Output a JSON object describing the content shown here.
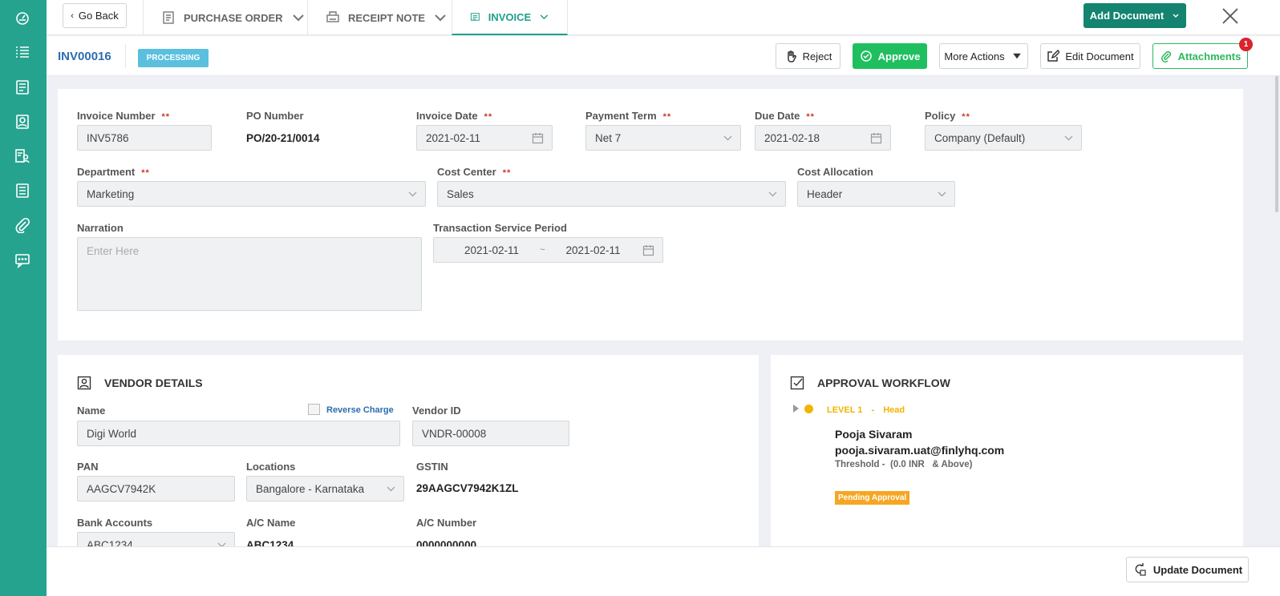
{
  "sidebar": {
    "icons": [
      "dashboard-icon",
      "list-icon",
      "document-icon",
      "contact-icon",
      "people-report-icon",
      "report-icon",
      "attachment-icon",
      "chat-icon"
    ]
  },
  "topbar": {
    "go_back": "Go Back",
    "tabs": [
      {
        "label": "PURCHASE ORDER",
        "icon": "purchase-order-icon"
      },
      {
        "label": "RECEIPT NOTE",
        "icon": "receipt-note-icon"
      },
      {
        "label": "INVOICE",
        "icon": "invoice-icon",
        "active": true
      }
    ],
    "add_document": "Add Document"
  },
  "actionbar": {
    "doc_id": "INV00016",
    "status": "PROCESSING",
    "reject": "Reject",
    "approve": "Approve",
    "more_actions": "More Actions",
    "edit_document": "Edit Document",
    "attachments": "Attachments",
    "attachments_count": "1"
  },
  "form": {
    "invoice_number": {
      "label": "Invoice Number",
      "value": "INV5786",
      "required": "**"
    },
    "po_number": {
      "label": "PO Number",
      "value": "PO/20-21/0014"
    },
    "invoice_date": {
      "label": "Invoice Date",
      "value": "2021-02-11",
      "required": "**"
    },
    "payment_term": {
      "label": "Payment Term",
      "value": "Net 7",
      "required": "**"
    },
    "due_date": {
      "label": "Due Date",
      "value": "2021-02-18",
      "required": "**"
    },
    "policy": {
      "label": "Policy",
      "value": "Company (Default)",
      "required": "**"
    },
    "department": {
      "label": "Department",
      "value": "Marketing",
      "required": "**"
    },
    "cost_center": {
      "label": "Cost Center",
      "value": "Sales",
      "required": "**"
    },
    "cost_allocation": {
      "label": "Cost Allocation",
      "value": "Header"
    },
    "narration": {
      "label": "Narration",
      "placeholder": "Enter Here"
    },
    "service_period": {
      "label": "Transaction Service Period",
      "from": "2021-02-11",
      "sep": "~",
      "to": "2021-02-11"
    }
  },
  "vendor": {
    "title": "VENDOR DETAILS",
    "name": {
      "label": "Name",
      "value": "Digi World"
    },
    "reverse_charge": "Reverse Charge",
    "vendor_id": {
      "label": "Vendor ID",
      "value": "VNDR-00008"
    },
    "pan": {
      "label": "PAN",
      "value": "AAGCV7942K"
    },
    "locations": {
      "label": "Locations",
      "value": "Bangalore - Karnataka"
    },
    "gstin": {
      "label": "GSTIN",
      "value": "29AAGCV7942K1ZL"
    },
    "bank_accounts": {
      "label": "Bank Accounts",
      "value": "ABC1234"
    },
    "ac_name": {
      "label": "A/C Name",
      "value": "ABC1234"
    },
    "ac_number": {
      "label": "A/C Number",
      "value": "0000000000"
    }
  },
  "workflow": {
    "title": "APPROVAL WORKFLOW",
    "level": "LEVEL 1",
    "level_sep": "-",
    "level_role": "Head",
    "approver_name": "Pooja Sivaram",
    "approver_email": "pooja.sivaram.uat@finlyhq.com",
    "threshold": "Threshold -  (0.0 INR   & Above)",
    "status": "Pending Approval"
  },
  "footer": {
    "update_document": "Update Document"
  },
  "colors": {
    "sidebar": "#26a38f",
    "accent": "#14836f",
    "approve": "#1fbf5f",
    "status_badge": "#5bc0de",
    "level": "#f0b400",
    "pending": "#f6a623"
  }
}
